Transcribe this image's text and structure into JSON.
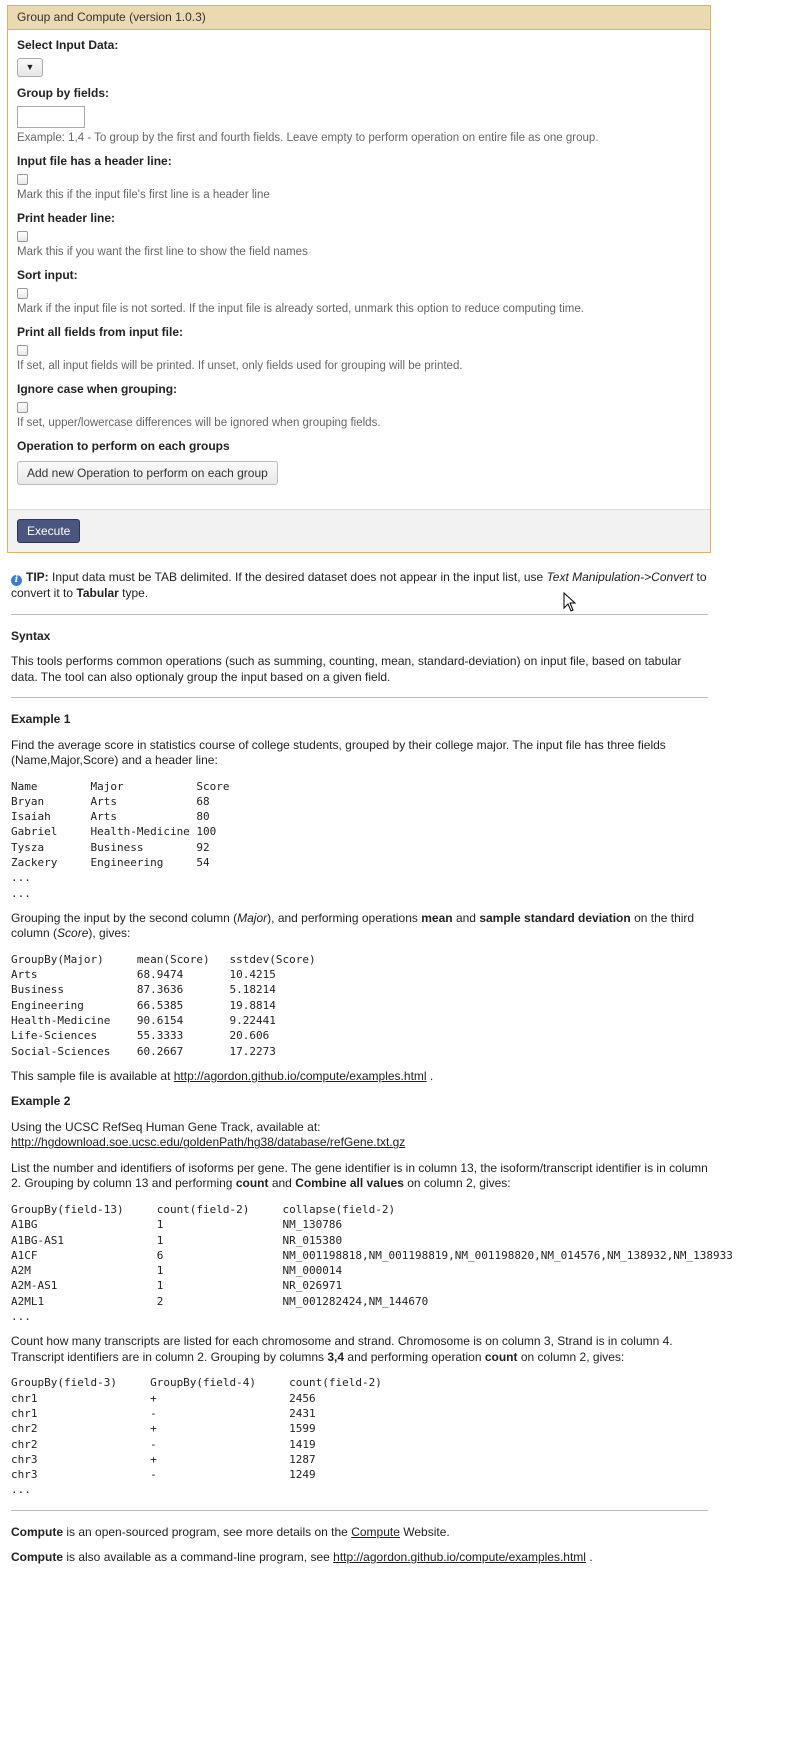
{
  "tool": {
    "title": "Group and Compute (version 1.0.3)",
    "input_data_label": "Select Input Data:",
    "select_arrow": "▼",
    "group_by_label": "Group by fields:",
    "group_by_value": "",
    "group_by_help": "Example: 1,4 - To group by the first and fourth fields. Leave empty to perform operation on entire file as one group.",
    "header_line_label": "Input file has a header line:",
    "header_line_help": "Mark this if the input file's first line is a header line",
    "print_header_label": "Print header line:",
    "print_header_help": "Mark this if you want the first line to show the field names",
    "sort_label": "Sort input:",
    "sort_help": "Mark if the input file is not sorted. If the input file is already sorted, unmark this option to reduce computing time.",
    "print_all_label": "Print all fields from input file:",
    "print_all_help": "If set, all input fields will be printed. If unset, only fields used for grouping will be printed.",
    "ignore_case_label": "Ignore case when grouping:",
    "ignore_case_help": "If set, upper/lowercase differences will be ignored when grouping fields.",
    "operation_label": "Operation to perform on each groups",
    "add_operation_button": "Add new Operation to perform on each group",
    "execute_button": "Execute"
  },
  "help": {
    "tip_label": "TIP:",
    "tip_text_1": "Input data must be TAB delimited. If the desired dataset does not appear in the input list, use",
    "tip_italic": "Text Manipulation->Convert",
    "tip_text_2": "to convert it to",
    "tip_bold": "Tabular",
    "tip_text_3": "type.",
    "syntax_title": "Syntax",
    "syntax_text": "This tools performs common operations (such as summing, counting, mean, standard-deviation) on input file, based on tabular data. The tool can also optionaly group the input based on a given field.",
    "example1_title": "Example 1",
    "example1_intro": "Find the average score in statistics course of college students, grouped by their college major. The input file has three fields (Name,Major,Score) and a header line:",
    "example1_input": "Name        Major           Score\nBryan       Arts            68\nIsaiah      Arts            80\nGabriel     Health-Medicine 100\nTysza       Business        92\nZackery     Engineering     54\n...\n...",
    "example1_mid_1": "Grouping the input by the second column (",
    "example1_mid_major": "Major",
    "example1_mid_2": "), and performing operations",
    "example1_mid_mean": "mean",
    "example1_mid_and": "and",
    "example1_mid_ssd": "sample standard deviation",
    "example1_mid_3": "on the third column (",
    "example1_mid_score": "Score",
    "example1_mid_4": "), gives:",
    "example1_output": "GroupBy(Major)     mean(Score)   sstdev(Score)\nArts               68.9474       10.4215\nBusiness           87.3636       5.18214\nEngineering        66.5385       19.8814\nHealth-Medicine    90.6154       9.22441\nLife-Sciences      55.3333       20.606\nSocial-Sciences    60.2667       17.2273",
    "sample_file_text": "This sample file is available at",
    "sample_file_link": "http://agordon.github.io/compute/examples.html",
    "sample_file_end": ".",
    "example2_title": "Example 2",
    "example2_intro": "Using the UCSC RefSeq Human Gene Track, available at:",
    "example2_link": "http://hgdownload.soe.ucsc.edu/goldenPath/hg38/database/refGene.txt.gz",
    "example2_desc_1": "List the number and identifiers of isoforms per gene. The gene identifier is in column 13, the isoform/transcript identifier is in column 2. Grouping by column 13 and performing",
    "example2_desc_count": "count",
    "example2_desc_and": "and",
    "example2_desc_combine": "Combine all values",
    "example2_desc_2": "on column 2, gives:",
    "example2_output": "GroupBy(field-13)     count(field-2)     collapse(field-2)\nA1BG                  1                  NM_130786\nA1BG-AS1              1                  NR_015380\nA1CF                  6                  NM_001198818,NM_001198819,NM_001198820,NM_014576,NM_138932,NM_138933\nA2M                   1                  NM_000014\nA2M-AS1               1                  NR_026971\nA2ML1                 2                  NM_001282424,NM_144670\n...",
    "example3_desc_1": "Count how many transcripts are listed for each chromosome and strand. Chromosome is on column 3, Strand is in column 4. Transcript identifiers are in column 2. Grouping by columns",
    "example3_desc_cols": "3,4",
    "example3_desc_2": "and performing operation",
    "example3_desc_count": "count",
    "example3_desc_3": "on column 2, gives:",
    "example3_output": "GroupBy(field-3)     GroupBy(field-4)     count(field-2)\nchr1                 +                    2456\nchr1                 -                    2431\nchr2                 +                    1599\nchr2                 -                    1419\nchr3                 +                    1287\nchr3                 -                    1249\n...",
    "compute_bold": "Compute",
    "footer1_text": "is an open-sourced program, see more details on the",
    "footer1_link": "Compute",
    "footer1_end": "Website.",
    "footer2_text": "is also available as a command-line program, see",
    "footer2_link": "http://agordon.github.io/compute/examples.html",
    "footer2_end": "."
  }
}
